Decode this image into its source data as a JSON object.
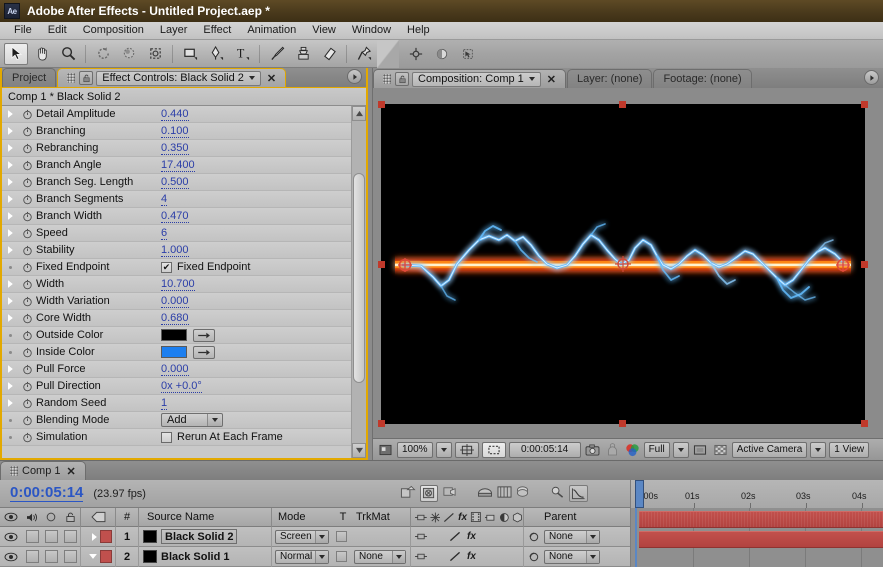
{
  "window": {
    "logo_text": "Ae",
    "title": "Adobe After Effects - Untitled Project.aep *"
  },
  "menubar": {
    "items": [
      "File",
      "Edit",
      "Composition",
      "Layer",
      "Effect",
      "Animation",
      "View",
      "Window",
      "Help"
    ]
  },
  "toolbar": {
    "tools": [
      {
        "name": "selection-tool",
        "selected": true
      },
      {
        "name": "hand-tool",
        "selected": false
      },
      {
        "name": "zoom-tool",
        "selected": false
      },
      {
        "name": "rotation-tool",
        "selected": false
      },
      {
        "name": "orbit-camera-tool",
        "selected": false
      },
      {
        "name": "pan-behind-tool",
        "selected": false
      },
      {
        "name": "rectangle-tool",
        "selected": false
      },
      {
        "name": "pen-tool",
        "selected": false
      },
      {
        "name": "type-tool",
        "selected": false
      },
      {
        "name": "brush-tool",
        "selected": false
      },
      {
        "name": "clone-stamp-tool",
        "selected": false
      },
      {
        "name": "eraser-tool",
        "selected": false
      },
      {
        "name": "puppet-pin-tool",
        "selected": false
      }
    ],
    "right_tools": [
      {
        "name": "anchor-point-tool"
      },
      {
        "name": "mask-feather-tool"
      },
      {
        "name": "snapping-toggle"
      }
    ]
  },
  "effect_controls": {
    "tabs": [
      {
        "label": "Project",
        "active": false
      },
      {
        "label": "Effect Controls: Black Solid 2",
        "active": true,
        "has_dropdown": true,
        "has_close": true
      }
    ],
    "header": "Comp 1 * Black Solid 2",
    "rows": [
      {
        "label": "Detail Amplitude",
        "type": "number",
        "value": "0.440",
        "twirl": true
      },
      {
        "label": "Branching",
        "type": "number",
        "value": "0.100",
        "twirl": true
      },
      {
        "label": "Rebranching",
        "type": "number",
        "value": "0.350",
        "twirl": true
      },
      {
        "label": "Branch Angle",
        "type": "number",
        "value": "17.400",
        "twirl": true
      },
      {
        "label": "Branch Seg. Length",
        "type": "number",
        "value": "0.500",
        "twirl": true
      },
      {
        "label": "Branch Segments",
        "type": "number",
        "value": "4",
        "twirl": true
      },
      {
        "label": "Branch Width",
        "type": "number",
        "value": "0.470",
        "twirl": true
      },
      {
        "label": "Speed",
        "type": "number",
        "value": "6",
        "twirl": true
      },
      {
        "label": "Stability",
        "type": "number",
        "value": "1.000",
        "twirl": true
      },
      {
        "label": "Fixed Endpoint",
        "type": "checkbox",
        "value": "Fixed Endpoint",
        "checked": true,
        "twirl": false
      },
      {
        "label": "Width",
        "type": "number",
        "value": "10.700",
        "twirl": true
      },
      {
        "label": "Width Variation",
        "type": "number",
        "value": "0.000",
        "twirl": true
      },
      {
        "label": "Core Width",
        "type": "number",
        "value": "0.680",
        "twirl": true
      },
      {
        "label": "Outside Color",
        "type": "color",
        "value": "#000000",
        "twirl": false
      },
      {
        "label": "Inside Color",
        "type": "color",
        "value": "#1c7ff0",
        "twirl": false
      },
      {
        "label": "Pull Force",
        "type": "number",
        "value": "0.000",
        "twirl": true
      },
      {
        "label": "Pull Direction",
        "type": "number",
        "value": "0x +0.0°",
        "twirl": true
      },
      {
        "label": "Random Seed",
        "type": "number",
        "value": "1",
        "twirl": true
      },
      {
        "label": "Blending Mode",
        "type": "select",
        "value": "Add",
        "twirl": false
      },
      {
        "label": "Simulation",
        "type": "checkbox",
        "value": "Rerun At Each Frame",
        "checked": false,
        "twirl": false
      }
    ]
  },
  "composition_panel": {
    "tabs": [
      {
        "label": "Composition: Comp 1",
        "active": true,
        "has_dropdown": true,
        "has_close": true
      },
      {
        "label": "Layer: (none)",
        "active": false
      },
      {
        "label": "Footage: (none)",
        "active": false
      }
    ],
    "bottom_bar": {
      "magnification": "100%",
      "timecode": "0:00:05:14",
      "resolution": "Full",
      "view_select": "Active Camera",
      "view_layout": "1 View"
    }
  },
  "timeline": {
    "tabs": [
      {
        "label": "Comp 1",
        "active": true,
        "has_close": true
      }
    ],
    "current_time": "0:00:05:14",
    "fps": "(23.97 fps)",
    "columns": [
      "#",
      "Source Name",
      "Mode",
      "T",
      "TrkMat",
      "Parent"
    ],
    "ruler_ticks": [
      "0:00s",
      "01s",
      "02s",
      "03s",
      "04s"
    ],
    "layers": [
      {
        "index": "1",
        "source_name": "Black Solid 2",
        "mode": "Screen",
        "trkmat": "",
        "parent": "None",
        "color": "#c0504d",
        "expanded": false,
        "has_effects": true
      },
      {
        "index": "2",
        "source_name": "Black Solid 1",
        "mode": "Normal",
        "trkmat": "None",
        "parent": "None",
        "color": "#c0504d",
        "expanded": true,
        "has_effects": true
      }
    ]
  },
  "colors": {
    "accent_yellow": "#e3a900",
    "title_brown": "#4a3a1c",
    "value_blue": "#2b3ea8",
    "time_blue": "#2b56c4",
    "layer_red": "#c0504d"
  }
}
